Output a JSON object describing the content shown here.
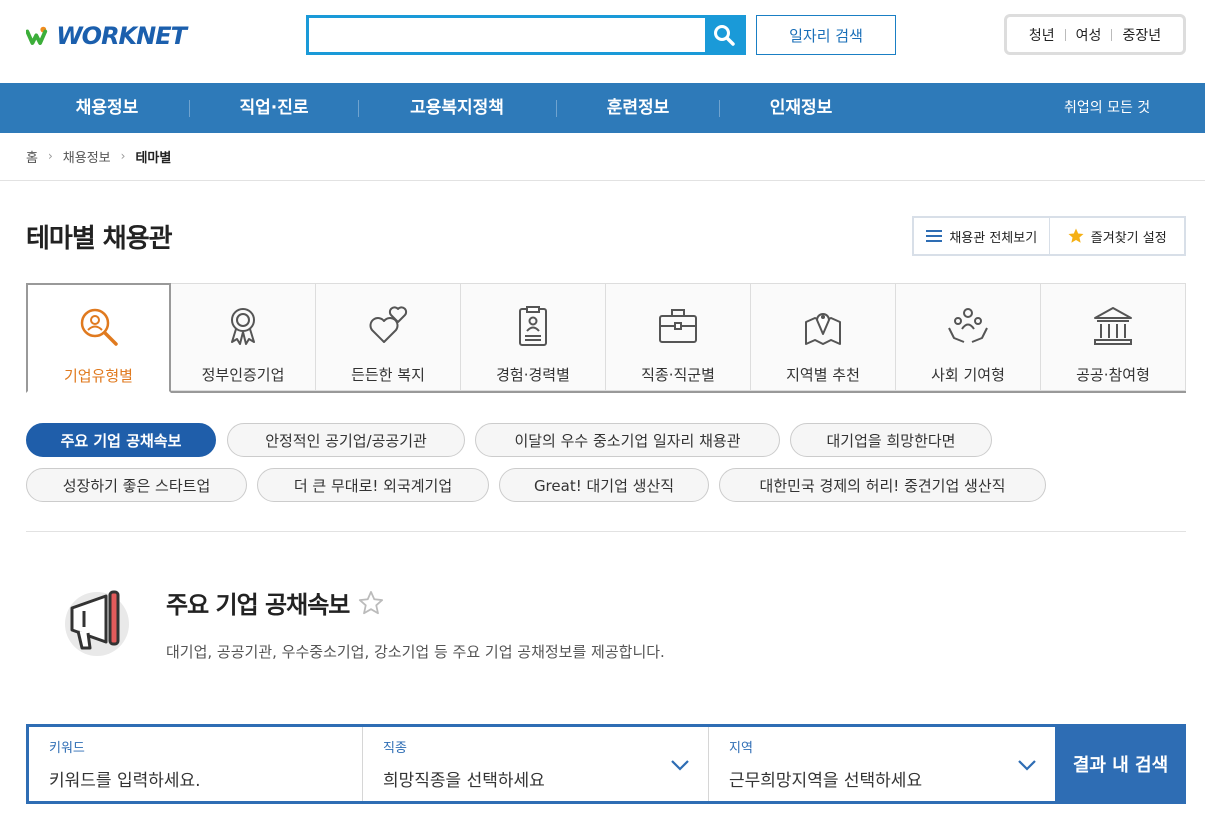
{
  "header": {
    "logo_text": "WORKNET",
    "search_placeholder": "",
    "job_search_label": "일자리 검색",
    "user_links": [
      "청년",
      "여성",
      "중장년"
    ]
  },
  "nav": {
    "items": [
      "채용정보",
      "직업·진로",
      "고용복지정책",
      "훈련정보",
      "인재정보"
    ],
    "right_label": "취업의 모든 것"
  },
  "breadcrumb": [
    "홈",
    "채용정보",
    "테마별"
  ],
  "page_title": "테마별 채용관",
  "top_buttons": {
    "view_all": "채용관 전체보기",
    "favorites": "즐겨찾기 설정"
  },
  "tabs": [
    {
      "label": "기업유형별",
      "icon": "search-person-icon",
      "active": true
    },
    {
      "label": "정부인증기업",
      "icon": "award-ribbon-icon",
      "active": false
    },
    {
      "label": "든든한 복지",
      "icon": "hearts-icon",
      "active": false
    },
    {
      "label": "경험·경력별",
      "icon": "clipboard-profile-icon",
      "active": false
    },
    {
      "label": "직종·직군별",
      "icon": "briefcase-icon",
      "active": false
    },
    {
      "label": "지역별 추천",
      "icon": "map-pin-icon",
      "active": false
    },
    {
      "label": "사회 기여형",
      "icon": "community-hands-icon",
      "active": false
    },
    {
      "label": "공공·참여형",
      "icon": "public-building-icon",
      "active": false
    }
  ],
  "chips": [
    "주요 기업 공채속보",
    "안정적인 공기업/공공기관",
    "이달의 우수 중소기업 일자리 채용관",
    "대기업을 희망한다면",
    "성장하기 좋은 스타트업",
    "더 큰 무대로! 외국계기업",
    "Great! 대기업 생산직",
    "대한민국 경제의 허리! 중견기업 생산직"
  ],
  "section": {
    "title": "주요 기업 공채속보",
    "desc": "대기업, 공공기관, 우수중소기업, 강소기업 등 주요 기업 공채정보를 제공합니다."
  },
  "form": {
    "keyword_label": "키워드",
    "keyword_placeholder": "키워드를 입력하세요.",
    "job_label": "직종",
    "job_value": "희망직종을 선택하세요",
    "region_label": "지역",
    "region_value": "근무희망지역을 선택하세요",
    "submit_label": "결과 내 검색"
  },
  "colors": {
    "brand_blue": "#2e7ab9",
    "accent_orange": "#e07a1f",
    "chip_active": "#1f5eaa"
  }
}
